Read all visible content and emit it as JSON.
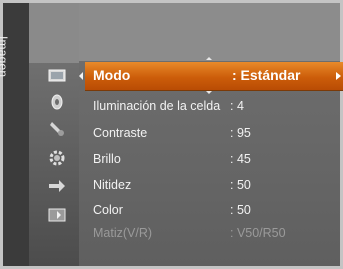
{
  "side_tab": {
    "label": "Imagen"
  },
  "icons": [
    {
      "name": "picture-icon"
    },
    {
      "name": "sound-icon"
    },
    {
      "name": "channel-icon"
    },
    {
      "name": "setup-icon"
    },
    {
      "name": "input-icon"
    },
    {
      "name": "application-icon"
    }
  ],
  "menu": {
    "selected": {
      "label": "Modo",
      "value": ": Estándar"
    },
    "items": [
      {
        "label": "Iluminación de la celda",
        "value": ": 4",
        "enabled": true
      },
      {
        "label": "Contraste",
        "value": ": 95",
        "enabled": true
      },
      {
        "label": "Brillo",
        "value": ": 45",
        "enabled": true
      },
      {
        "label": "Nitidez",
        "value": ": 50",
        "enabled": true
      },
      {
        "label": "Color",
        "value": ": 50",
        "enabled": true
      },
      {
        "label": "Matiz(V/R)",
        "value": ": V50/R50",
        "enabled": false
      }
    ]
  },
  "colors": {
    "highlight": "#d96a14",
    "panel": "#666666",
    "side_tab": "#3b3b3b"
  }
}
